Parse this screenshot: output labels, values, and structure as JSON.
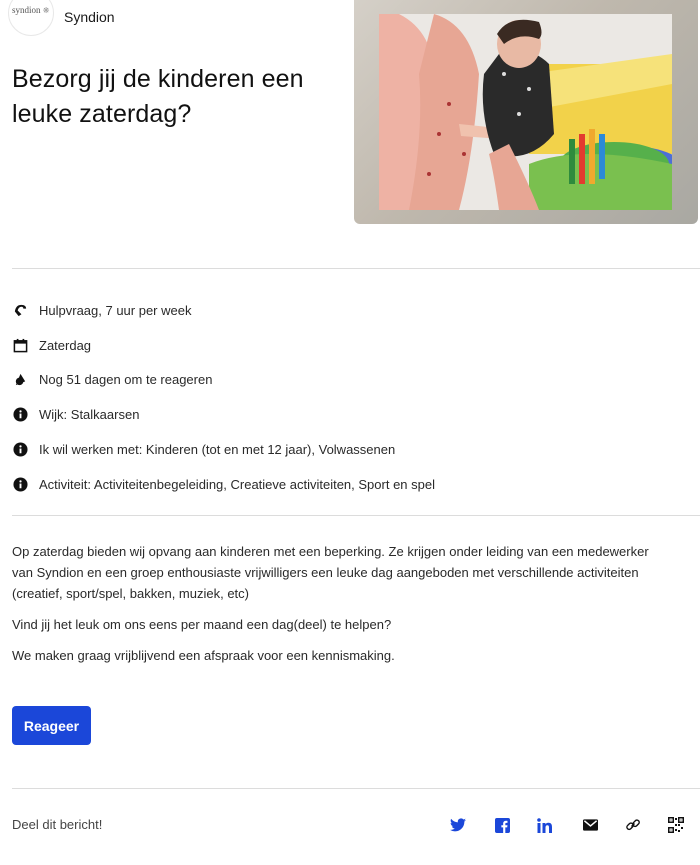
{
  "header": {
    "logo_text": "syndion",
    "org_name": "Syndion",
    "title": "Bezorg jij de kinderen een leuke zaterdag?"
  },
  "info": [
    {
      "icon": "help-hand-icon",
      "text": "Hulpvraag, 7 uur per week"
    },
    {
      "icon": "calendar-icon",
      "text": "Zaterdag"
    },
    {
      "icon": "clock-icon",
      "text": "Nog 51 dagen om te reageren"
    },
    {
      "icon": "info-icon",
      "text": "Wijk: Stalkaarsen"
    },
    {
      "icon": "info-icon",
      "text": "Ik wil werken met: Kinderen (tot en met 12 jaar), Volwassenen"
    },
    {
      "icon": "info-icon",
      "text": "Activiteit: Activiteitenbegeleiding, Creatieve activiteiten, Sport en spel"
    }
  ],
  "description": [
    "Op zaterdag bieden wij opvang aan kinderen met een beperking. Ze krijgen onder leiding van een medewerker van Syndion en een groep enthousiaste vrijwilligers een leuke dag aangeboden met verschillende activiteiten (creatief, sport/spel, bakken, muziek, etc)",
    "Vind jij het leuk om ons eens per maand een dag(deel) te helpen?",
    "We maken graag vrijblijvend een afspraak voor een kennismaking."
  ],
  "cta": {
    "label": "Reageer",
    "color": "#1b47d9"
  },
  "share": {
    "label": "Deel dit bericht!",
    "icons": [
      "twitter-icon",
      "facebook-icon",
      "linkedin-icon",
      "email-icon",
      "link-icon",
      "qr-code-icon"
    ],
    "accent": "#1b47d9"
  }
}
